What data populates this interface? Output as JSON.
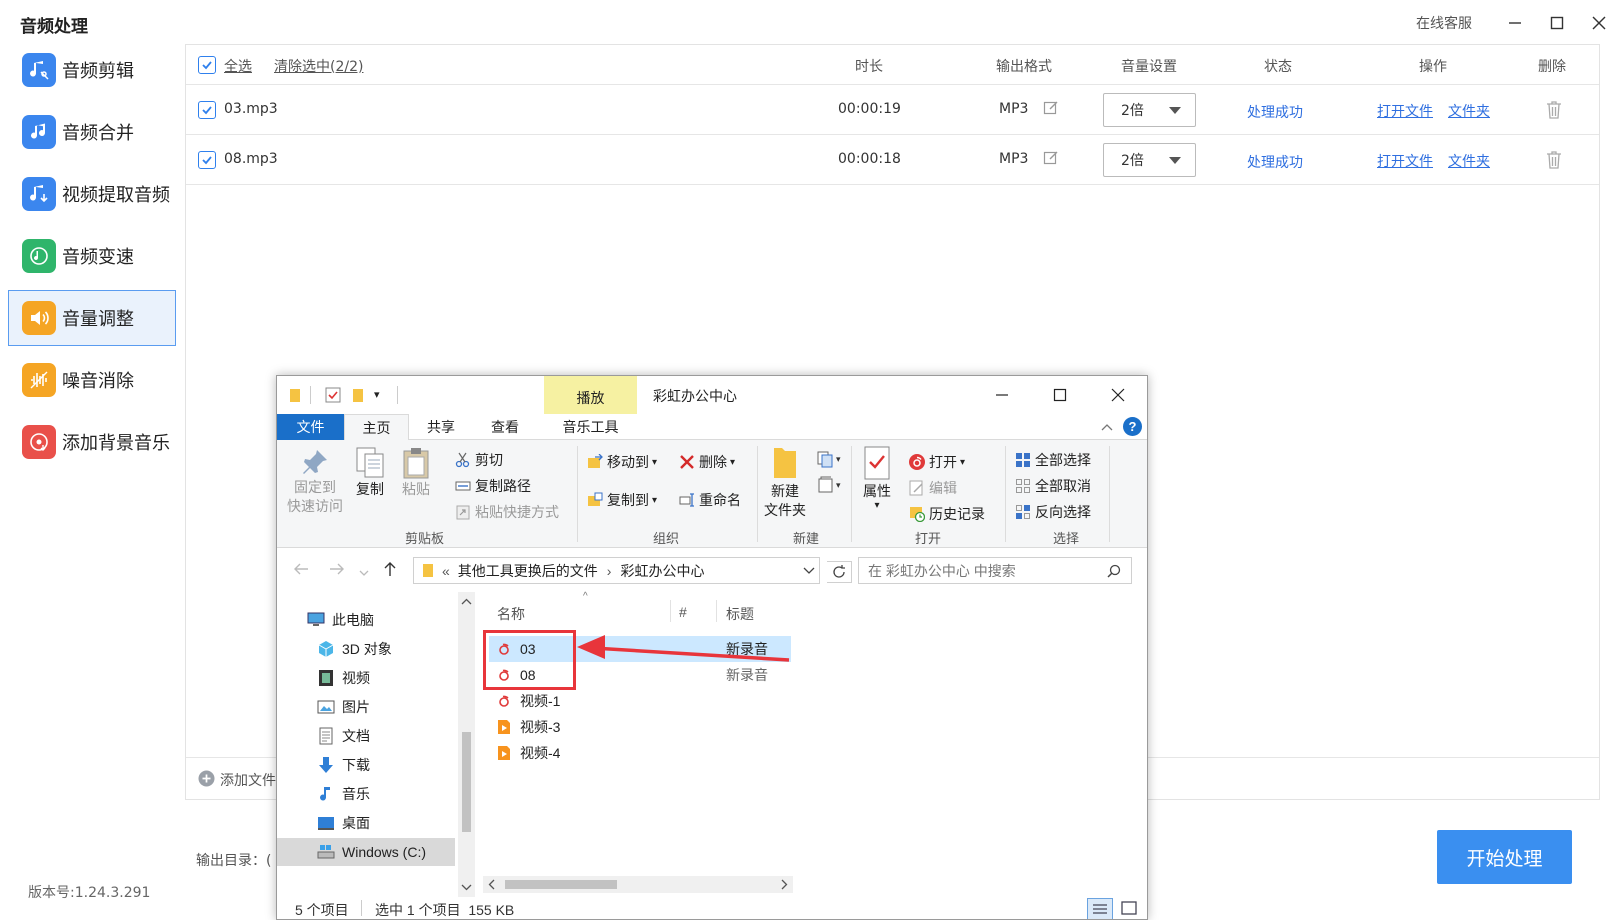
{
  "app": {
    "title": "音频处理",
    "online_service": "在线客服",
    "version": "版本号:1.24.3.291"
  },
  "sidebar": {
    "items": [
      {
        "label": "音频剪辑",
        "icon": "music-scissors-icon",
        "color": "#3b86ee"
      },
      {
        "label": "音频合并",
        "icon": "music-note-icon",
        "color": "#3b86ee"
      },
      {
        "label": "视频提取音频",
        "icon": "music-extract-icon",
        "color": "#3b86ee"
      },
      {
        "label": "音频变速",
        "icon": "music-speed-icon",
        "color": "#2fb56b"
      },
      {
        "label": "音量调整",
        "icon": "volume-icon",
        "color": "#f5a524"
      },
      {
        "label": "噪音消除",
        "icon": "noise-icon",
        "color": "#f5a524"
      },
      {
        "label": "添加背景音乐",
        "icon": "bg-music-icon",
        "color": "#e9504a"
      }
    ],
    "active_index": 4
  },
  "table": {
    "select_all": "全选",
    "clear_selection": "清除选中(2/2)",
    "headers": {
      "duration": "时长",
      "format": "输出格式",
      "volume": "音量设置",
      "status": "状态",
      "actions": "操作",
      "delete": "删除"
    },
    "rows": [
      {
        "name": "03.mp3",
        "duration": "00:00:19",
        "format": "MP3",
        "volume": "2倍",
        "status": "处理成功",
        "open_file": "打开文件",
        "open_folder": "文件夹"
      },
      {
        "name": "08.mp3",
        "duration": "00:00:18",
        "format": "MP3",
        "volume": "2倍",
        "status": "处理成功",
        "open_file": "打开文件",
        "open_folder": "文件夹"
      }
    ],
    "add_file": "添加文件"
  },
  "output": {
    "label": "输出目录：("
  },
  "start_button": "开始处理",
  "colors": {
    "accent": "#3a8ff0",
    "link": "#2f6fe0",
    "selected_row": "#cce8ff",
    "annotation": "#e8353b"
  },
  "explorer": {
    "context_tab": "播放",
    "title": "彩虹办公中心",
    "tabs": [
      "文件",
      "主页",
      "共享",
      "查看",
      "音乐工具"
    ],
    "ribbon": {
      "clipboard": {
        "pin_line1": "固定到",
        "pin_line2": "快速访问",
        "copy": "复制",
        "paste": "粘贴",
        "cut": "剪切",
        "copy_path": "复制路径",
        "paste_shortcut": "粘贴快捷方式",
        "group": "剪贴板"
      },
      "organize": {
        "move_to": "移动到",
        "copy_to": "复制到",
        "delete": "删除",
        "rename": "重命名",
        "group": "组织"
      },
      "new": {
        "folder_line1": "新建",
        "folder_line2": "文件夹",
        "group": "新建"
      },
      "open": {
        "properties": "属性",
        "open": "打开",
        "edit": "编辑",
        "history": "历史记录",
        "group": "打开"
      },
      "select": {
        "select_all": "全部选择",
        "select_none": "全部取消",
        "invert": "反向选择",
        "group": "选择"
      }
    },
    "address": {
      "prefix": "«",
      "crumb1": "其他工具更换后的文件",
      "crumb2": "彩虹办公中心",
      "search_placeholder": "在 彩虹办公中心 中搜索"
    },
    "nav": [
      {
        "label": "此电脑",
        "icon": "pc-icon"
      },
      {
        "label": "3D 对象",
        "icon": "cube-icon"
      },
      {
        "label": "视频",
        "icon": "film-icon"
      },
      {
        "label": "图片",
        "icon": "picture-icon"
      },
      {
        "label": "文档",
        "icon": "document-icon"
      },
      {
        "label": "下载",
        "icon": "download-icon"
      },
      {
        "label": "音乐",
        "icon": "music-icon"
      },
      {
        "label": "桌面",
        "icon": "desktop-icon"
      },
      {
        "label": "Windows (C:)",
        "icon": "drive-icon"
      }
    ],
    "columns": {
      "name": "名称",
      "number": "#",
      "title": "标题"
    },
    "files": [
      {
        "name": "03",
        "title": "新录音",
        "icon": "netease-music-icon",
        "selected": true
      },
      {
        "name": "08",
        "title": "新录音",
        "icon": "netease-music-icon",
        "selected": false
      },
      {
        "name": "视频-1",
        "title": "",
        "icon": "netease-music-icon",
        "selected": false
      },
      {
        "name": "视频-3",
        "title": "",
        "icon": "video-file-icon",
        "selected": false
      },
      {
        "name": "视频-4",
        "title": "",
        "icon": "video-file-icon",
        "selected": false
      }
    ],
    "status": {
      "count": "5 个项目",
      "selection": "选中 1 个项目  155 KB"
    }
  }
}
